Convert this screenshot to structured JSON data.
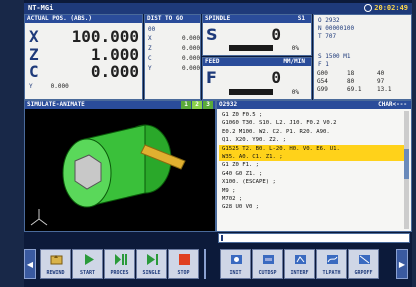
{
  "titlebar": {
    "mode": "NT-MGi",
    "time": "20:02:49"
  },
  "actual_position": {
    "title": "ACTUAL POS. (ABS.)",
    "axes": [
      {
        "axis": "X",
        "value": "100.000"
      },
      {
        "axis": "Z",
        "value": "1.000"
      },
      {
        "axis": "C",
        "value": "0.000"
      }
    ],
    "y_axis": "Y",
    "y_value": "0.000"
  },
  "distance_to_go": {
    "title": "DIST TO GO",
    "rows": [
      {
        "axis": "X",
        "value": "0.000"
      },
      {
        "axis": "Z",
        "value": "0.000"
      },
      {
        "axis": "C",
        "value": "0.000"
      },
      {
        "axis": "Y",
        "value": "0.000"
      }
    ],
    "header_extra": "00"
  },
  "spindle": {
    "title": "SPINDLE",
    "channel": "S1",
    "letter": "S",
    "value": "0",
    "percent": "0%",
    "load_fraction": 0.0
  },
  "feed": {
    "title": "FEED",
    "unit": "MM/MIN",
    "letter": "F",
    "value": "0",
    "percent": "0%",
    "load_fraction": 0.0
  },
  "info": {
    "program": "O 2932",
    "sequence": "N 00000100",
    "tool": "T 707",
    "spindle_line": "S  1500 M1",
    "f_line": "F    1",
    "mcodes": [
      [
        "G00",
        "18",
        "40"
      ],
      [
        "G54",
        "80",
        "97"
      ],
      [
        "G99",
        "69.1",
        "13.1"
      ]
    ]
  },
  "simulate": {
    "title": "SIMULATE-ANIMATE",
    "tabs": [
      "1",
      "2",
      "3"
    ]
  },
  "program": {
    "title": "O2932",
    "right": "CHAR<---",
    "lines": [
      "G1 Z0 F0.5 ;",
      "G1060 T30. S10. L2. J10. F0.2 V0.2",
      "E0.2 M100. W2. C2. P1. R20. A90.",
      "Q1. X20. Y90. Z2. ;",
      "G1525 T2. B0. L-20. H0. V0. E6. U1.",
      "W35. A0. C1. Z1. ;",
      "G1 Z0 F1. ;",
      "G40 G0 Z1. ;",
      "X100. (ESCAPE) ;",
      "M9 ;",
      "M702 ;",
      "G28 U0 V0 ;"
    ],
    "highlighted": [
      4,
      5
    ]
  },
  "softkeys_left": [
    {
      "label": "REWIND",
      "icon": "rewind-icon"
    },
    {
      "label": "START",
      "icon": "play-icon"
    },
    {
      "label": "PROCES",
      "icon": "play-pause-icon"
    },
    {
      "label": "SINGLE",
      "icon": "step-icon"
    },
    {
      "label": "STOP",
      "icon": "stop-icon"
    }
  ],
  "softkeys_right": [
    {
      "label": "INIT",
      "icon": "init-icon"
    },
    {
      "label": "CUTDSP",
      "icon": "cut-display-icon"
    },
    {
      "label": "INTERF",
      "icon": "interference-icon"
    },
    {
      "label": "TLPATH",
      "icon": "tool-path-icon"
    },
    {
      "label": "GRPOFF",
      "icon": "graph-off-icon"
    }
  ],
  "colors": {
    "panel_head": "#2a4c9a",
    "highlight": "#ffd21a",
    "accent_green": "#1aa64a"
  }
}
